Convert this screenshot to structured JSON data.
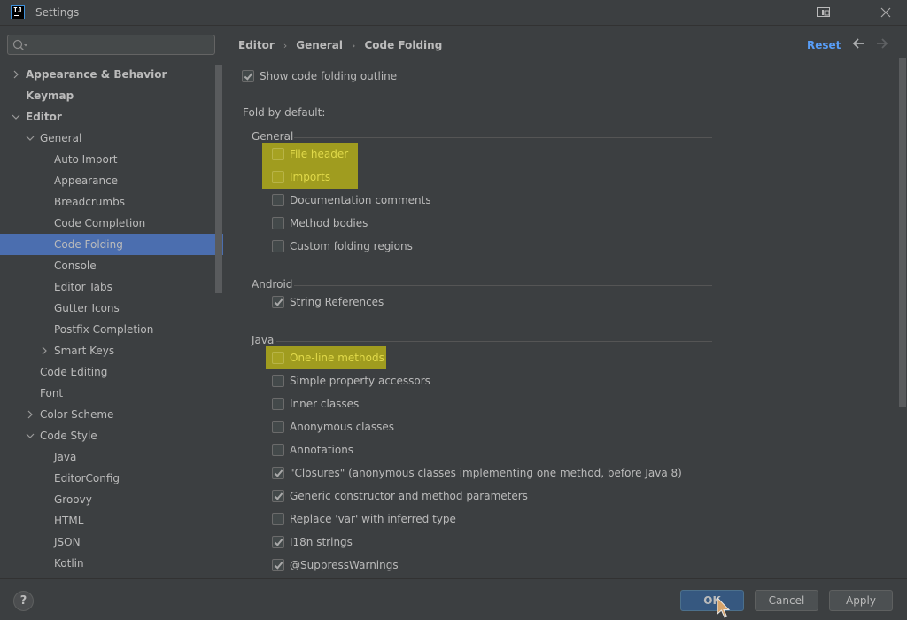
{
  "window": {
    "title": "Settings",
    "app_icon": "IJ"
  },
  "sidebar": {
    "search_placeholder": "",
    "items": [
      {
        "label": "Appearance & Behavior",
        "level": 0,
        "bold": true,
        "expander": "collapsed"
      },
      {
        "label": "Keymap",
        "level": 0,
        "bold": true,
        "expander": "none"
      },
      {
        "label": "Editor",
        "level": 0,
        "bold": true,
        "expander": "expanded"
      },
      {
        "label": "General",
        "level": 1,
        "bold": false,
        "expander": "expanded"
      },
      {
        "label": "Auto Import",
        "level": 2,
        "bold": false,
        "expander": "none"
      },
      {
        "label": "Appearance",
        "level": 2,
        "bold": false,
        "expander": "none"
      },
      {
        "label": "Breadcrumbs",
        "level": 2,
        "bold": false,
        "expander": "none"
      },
      {
        "label": "Code Completion",
        "level": 2,
        "bold": false,
        "expander": "none"
      },
      {
        "label": "Code Folding",
        "level": 2,
        "bold": false,
        "expander": "none",
        "selected": true
      },
      {
        "label": "Console",
        "level": 2,
        "bold": false,
        "expander": "none"
      },
      {
        "label": "Editor Tabs",
        "level": 2,
        "bold": false,
        "expander": "none"
      },
      {
        "label": "Gutter Icons",
        "level": 2,
        "bold": false,
        "expander": "none"
      },
      {
        "label": "Postfix Completion",
        "level": 2,
        "bold": false,
        "expander": "none"
      },
      {
        "label": "Smart Keys",
        "level": 2,
        "bold": false,
        "expander": "collapsed"
      },
      {
        "label": "Code Editing",
        "level": 1,
        "bold": false,
        "expander": "none"
      },
      {
        "label": "Font",
        "level": 1,
        "bold": false,
        "expander": "none"
      },
      {
        "label": "Color Scheme",
        "level": 1,
        "bold": false,
        "expander": "collapsed"
      },
      {
        "label": "Code Style",
        "level": 1,
        "bold": false,
        "expander": "expanded"
      },
      {
        "label": "Java",
        "level": 2,
        "bold": false,
        "expander": "none"
      },
      {
        "label": "EditorConfig",
        "level": 2,
        "bold": false,
        "expander": "none"
      },
      {
        "label": "Groovy",
        "level": 2,
        "bold": false,
        "expander": "none"
      },
      {
        "label": "HTML",
        "level": 2,
        "bold": false,
        "expander": "none"
      },
      {
        "label": "JSON",
        "level": 2,
        "bold": false,
        "expander": "none"
      },
      {
        "label": "Kotlin",
        "level": 2,
        "bold": false,
        "expander": "none"
      }
    ]
  },
  "header": {
    "breadcrumb": [
      "Editor",
      "General",
      "Code Folding"
    ],
    "reset_label": "Reset"
  },
  "main": {
    "show_outline": {
      "label": "Show code folding outline",
      "checked": true
    },
    "fold_by_default_label": "Fold by default:",
    "groups": [
      {
        "title": "General",
        "options": [
          {
            "label": "File header",
            "checked": false,
            "highlighted": true
          },
          {
            "label": "Imports",
            "checked": false,
            "highlighted": true
          },
          {
            "label": "Documentation comments",
            "checked": false
          },
          {
            "label": "Method bodies",
            "checked": false
          },
          {
            "label": "Custom folding regions",
            "checked": false
          }
        ]
      },
      {
        "title": "Android",
        "options": [
          {
            "label": "String References",
            "checked": true
          }
        ]
      },
      {
        "title": "Java",
        "options": [
          {
            "label": "One-line methods",
            "checked": false,
            "highlighted": true
          },
          {
            "label": "Simple property accessors",
            "checked": false
          },
          {
            "label": "Inner classes",
            "checked": false
          },
          {
            "label": "Anonymous classes",
            "checked": false
          },
          {
            "label": "Annotations",
            "checked": false
          },
          {
            "label": "\"Closures\" (anonymous classes implementing one method, before Java 8)",
            "checked": true
          },
          {
            "label": "Generic constructor and method parameters",
            "checked": true
          },
          {
            "label": "Replace 'var' with inferred type",
            "checked": false
          },
          {
            "label": "I18n strings",
            "checked": true
          },
          {
            "label": "@SuppressWarnings",
            "checked": true
          }
        ]
      }
    ]
  },
  "footer": {
    "help_label": "?",
    "ok_label": "OK",
    "cancel_label": "Cancel",
    "apply_label": "Apply"
  },
  "colors": {
    "background": "#3c3f41",
    "selection": "#4b6eaf",
    "link": "#589df6",
    "search_highlight": "#a09c1f",
    "ok_button": "#365880"
  }
}
